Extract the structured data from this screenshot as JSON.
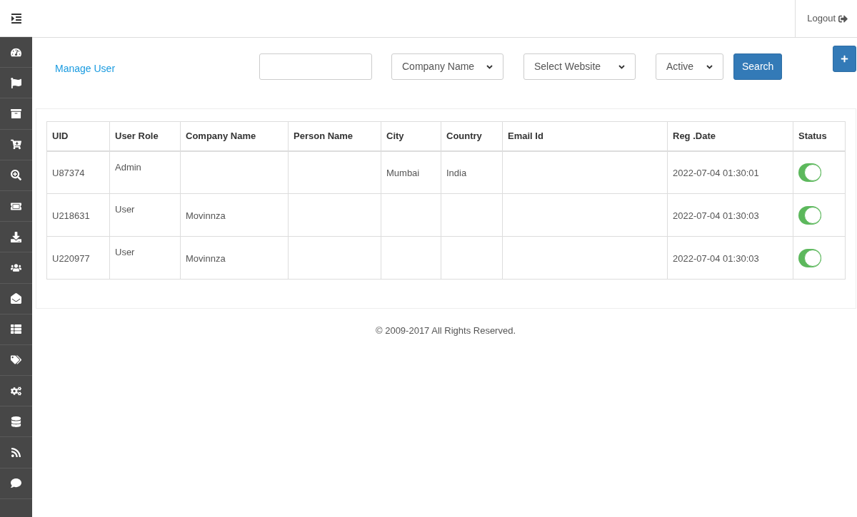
{
  "header": {
    "logout": "Logout"
  },
  "toolbar": {
    "title": "Manage User",
    "filters": [
      {
        "value": "Company Name"
      },
      {
        "value": "Select Website"
      },
      {
        "value": "Active"
      }
    ],
    "search_button": "Search"
  },
  "table": {
    "columns": [
      "UID",
      "User Role",
      "Company Name",
      "Person Name",
      "City",
      "Country",
      "Email Id",
      "Reg .Date",
      "Status"
    ],
    "rows": [
      {
        "cells": [
          "U87374",
          "Admin",
          "",
          "",
          "Mumbai",
          "India",
          "",
          "2022-07-04 01:30:01"
        ],
        "on": true
      },
      {
        "cells": [
          "U218631",
          "User",
          "Movinnza",
          "",
          "",
          "",
          "",
          "2022-07-04 01:30:03"
        ],
        "on": true
      },
      {
        "cells": [
          "U220977",
          "User",
          "Movinnza",
          "",
          "",
          "",
          "",
          "2022-07-04 01:30:03"
        ],
        "on": true
      }
    ]
  },
  "footer": "© 2009-2017 All Rights Reserved."
}
